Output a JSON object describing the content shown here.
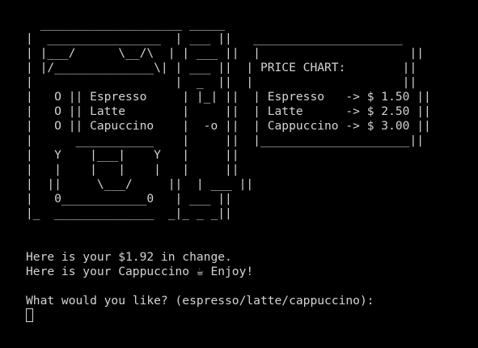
{
  "terminal": {
    "lines": [
      "  ____________________ _____",
      "|  ________________  | ___ ||   _____________________",
      "| |___/      \\__/\\  | | ___ ||  |                     ||",
      "| |/______________\\| | ___ ||  | PRICE CHART:        ||",
      "|                    |  _  ||  |                     ||",
      "|   O || Espresso     | |_| ||  | Espresso   -> $ 1.50 ||",
      "|   O || Latte        |     ||  | Latte      -> $ 2.50 ||",
      "|   O || Capuccino    |  -o ||  | Cappuccino -> $ 3.00 ||",
      "|      ___________    |     ||  |_____________________||",
      "|   Y    |___|    Y   |     ||",
      "|   |    |   |    |   |     ||",
      "|  ||     \\___/     ||  | ___ ||",
      "|   0____________0   | ___ ||",
      "|_  ______________  _|_ _ _||",
      "",
      "",
      "Here is your $1.92 in change.",
      "Here is your Cappuccino ☕ Enjoy!",
      "",
      "What would you like? (espresso/latte/cappuccino):"
    ]
  }
}
